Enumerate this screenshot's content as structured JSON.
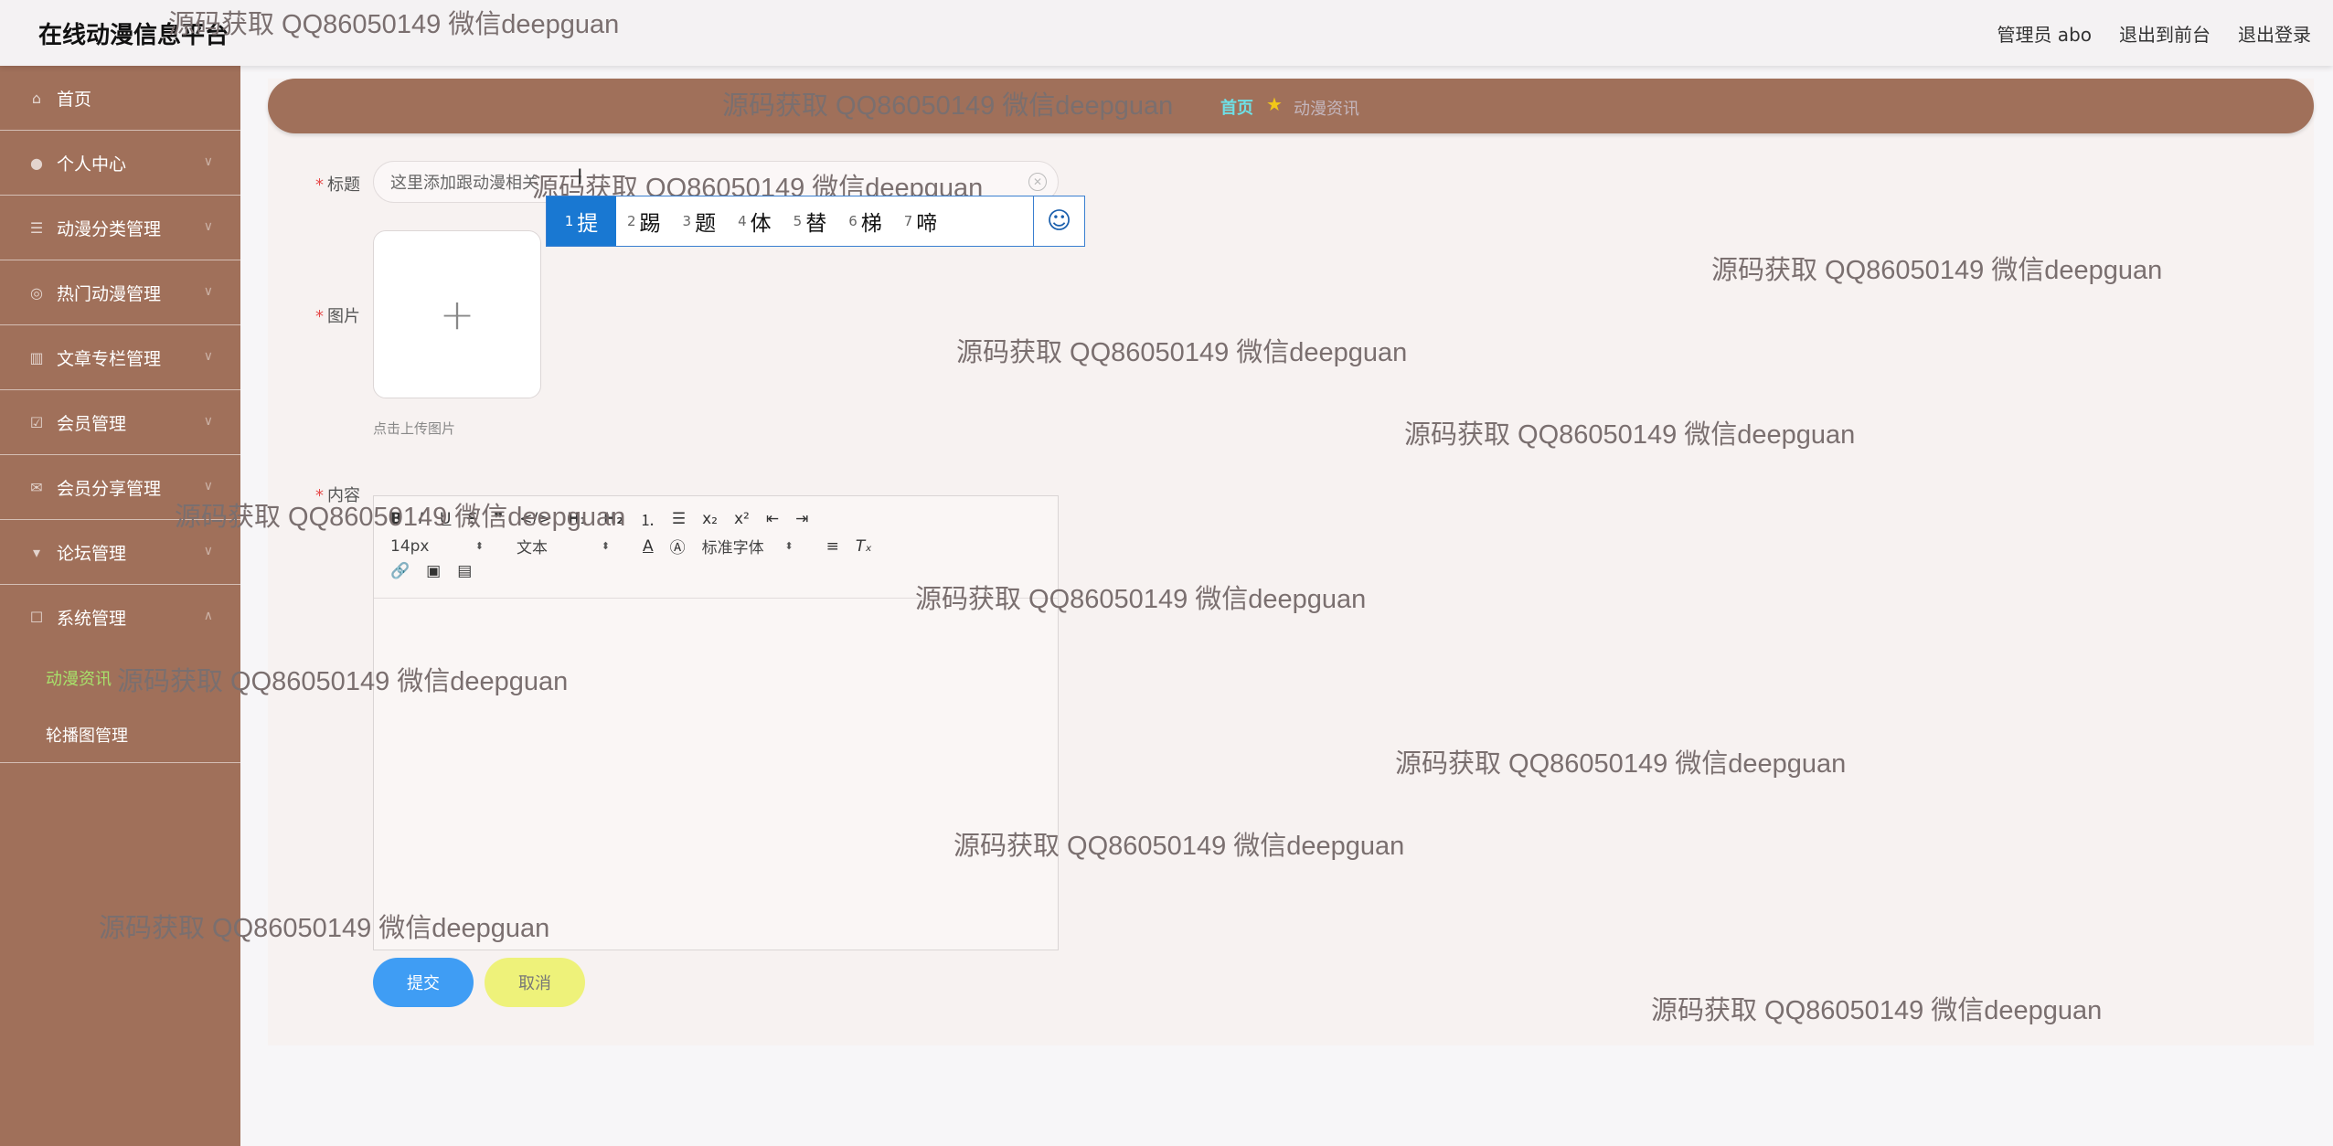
{
  "header": {
    "title": "在线动漫信息平台",
    "admin_label": "管理员 abo",
    "front_label": "退出到前台",
    "logout_label": "退出登录"
  },
  "sidebar": {
    "items": [
      {
        "label": "首页",
        "icon": "home-icon"
      },
      {
        "label": "个人中心",
        "icon": "user-icon"
      },
      {
        "label": "动漫分类管理",
        "icon": "list-icon"
      },
      {
        "label": "热门动漫管理",
        "icon": "circle-icon"
      },
      {
        "label": "文章专栏管理",
        "icon": "chart-icon"
      },
      {
        "label": "会员管理",
        "icon": "check-icon"
      },
      {
        "label": "会员分享管理",
        "icon": "mail-icon"
      },
      {
        "label": "论坛管理",
        "icon": "chat-icon"
      },
      {
        "label": "系统管理",
        "icon": "square-icon"
      }
    ],
    "sub_items": [
      {
        "label": "动漫资讯",
        "active": true
      },
      {
        "label": "轮播图管理",
        "active": false
      }
    ]
  },
  "breadcrumb": {
    "home": "首页",
    "current": "动漫资讯"
  },
  "form": {
    "title_label": "标题",
    "title_value": "这里添加跟动漫相关",
    "image_label": "图片",
    "upload_hint": "点击上传图片",
    "content_label": "内容",
    "submit_label": "提交",
    "cancel_label": "取消"
  },
  "editor": {
    "font_size": "14px",
    "paragraph": "文本",
    "font_family": "标准字体"
  },
  "ime": {
    "candidates": [
      {
        "num": "1",
        "char": "提"
      },
      {
        "num": "2",
        "char": "踢"
      },
      {
        "num": "3",
        "char": "题"
      },
      {
        "num": "4",
        "char": "体"
      },
      {
        "num": "5",
        "char": "替"
      },
      {
        "num": "6",
        "char": "梯"
      },
      {
        "num": "7",
        "char": "啼"
      }
    ]
  },
  "watermark": "源码获取 QQ86050149 微信deepguan",
  "colors": {
    "sidebar_bg": "#a0705a",
    "active_sub": "#a8e26b",
    "submit_btn": "#3f9df4",
    "cancel_btn": "#eef27a",
    "ime_selected": "#1978d2"
  }
}
